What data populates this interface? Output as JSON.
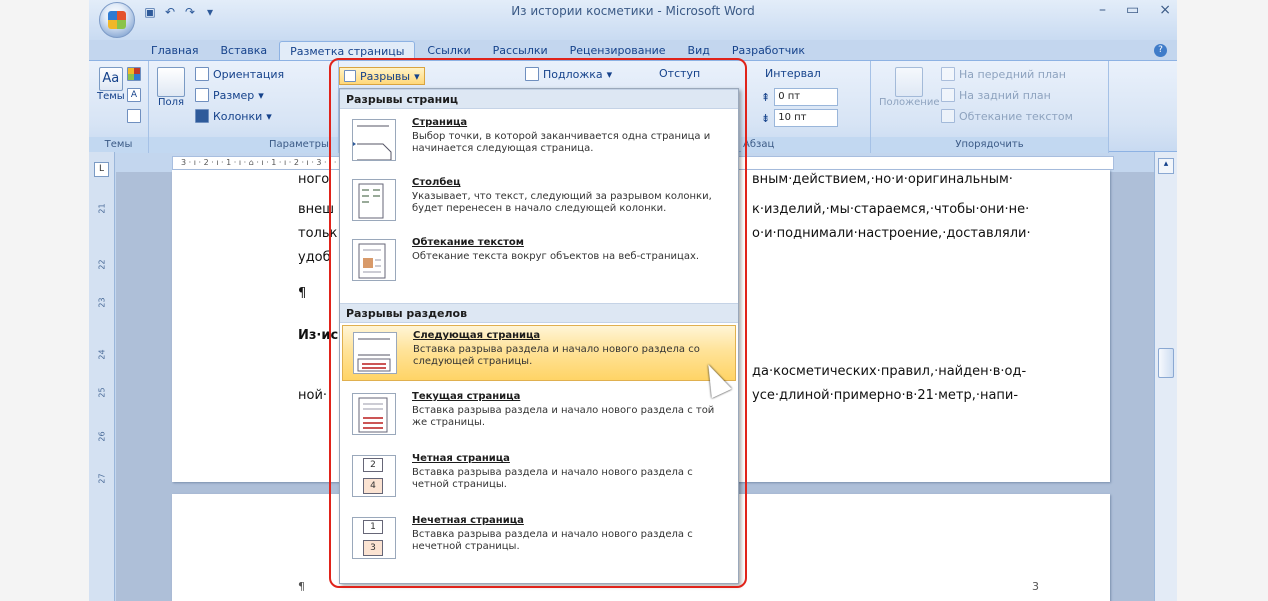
{
  "window": {
    "title": "Из истории косметики - Microsoft Word",
    "controls": [
      "–",
      "▭",
      "×"
    ]
  },
  "tabs": [
    "Главная",
    "Вставка",
    "Разметка страницы",
    "Ссылки",
    "Рассылки",
    "Рецензирование",
    "Вид",
    "Разработчик"
  ],
  "ribbon": {
    "themes": {
      "label": "Темы",
      "btn": "Темы"
    },
    "page_setup": {
      "label": "Параметры страницы",
      "fields_btn": "Поля",
      "orientation": "Ориентация",
      "size": "Размер",
      "columns": "Колонки",
      "breaks": "Разрывы"
    },
    "page_bg": {
      "watermark": "Подложка"
    },
    "paragraph": {
      "indent": "Отступ",
      "interval": "Интервал",
      "before_value": "0 пт",
      "after_value": "10 пт",
      "label": "Абзац"
    },
    "arrange": {
      "position": "Положение",
      "bring_front": "На передний план",
      "send_back": "На задний план",
      "text_wrap": "Обтекание текстом",
      "label": "Упорядочить"
    }
  },
  "ruler": {
    "horizontal": "3 · ı · 2 · ı · 1 · ı · ⌂ · ı · 1 · ı · 2 · ı · 3 · ı · 4 · ı · 5 · ı · 6 · ı · 7 · ı · 8 · ı · 9 · ı · 10 · ı · 11 · ı · 12 · ı · 13 · ı · 14 · ı · 15 · ı · 16 · △ · 17 · ı",
    "vertical": [
      "21",
      "22",
      "23",
      "24",
      "25",
      "26",
      "27"
    ]
  },
  "document": {
    "lines": [
      "ного",
      "внеш",
      "тольк",
      "удоб",
      "¶",
      "Из·ис",
      "ной·",
      "вным·действием,·но·и·оригинальным·",
      "к·изделий,·мы·стараемся,·чтобы·они·не·",
      "о·и·поднимали·настроение,·доставляли·",
      "да·косметических·правил,·найден·в·од-",
      "усе·длиной·примерно·в·21·метр,·напи-"
    ],
    "page_number": "3",
    "pilcrow": "¶"
  },
  "menu": {
    "page_breaks_header": "Разрывы страниц",
    "section_breaks_header": "Разрывы разделов",
    "items": [
      {
        "title": "Страница",
        "desc": "Выбор точки, в которой заканчивается одна страница и начинается следующая страница."
      },
      {
        "title": "Столбец",
        "desc": "Указывает, что текст, следующий за разрывом колонки, будет перенесен в начало следующей колонки."
      },
      {
        "title": "Обтекание текстом",
        "desc": "Обтекание текста вокруг объектов на веб-страницах."
      },
      {
        "title": "Следующая страница",
        "desc": "Вставка разрыва раздела и начало нового раздела со следующей страницы."
      },
      {
        "title": "Текущая страница",
        "desc": "Вставка разрыва раздела и начало нового раздела с той же страницы."
      },
      {
        "title": "Четная страница",
        "desc": "Вставка разрыва раздела и начало нового раздела с четной страницы."
      },
      {
        "title": "Нечетная страница",
        "desc": "Вставка разрыва раздела и начало нового раздела с нечетной страницы."
      }
    ],
    "icon_numbers": {
      "even_top": "2",
      "even_bottom": "4",
      "odd_top": "1",
      "odd_bottom": "3"
    }
  },
  "colors": {
    "accent": "#15428b",
    "highlight": "#ffd466",
    "annotation": "#e0231a"
  }
}
